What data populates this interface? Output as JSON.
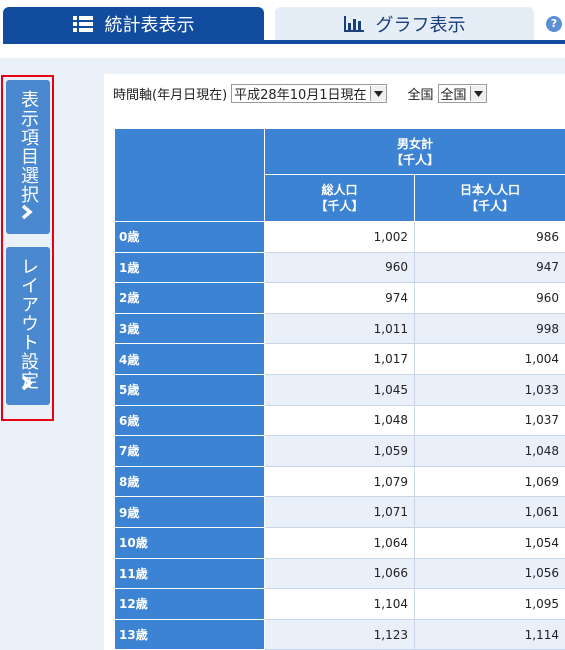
{
  "tabs": {
    "table": "統計表表示",
    "graph": "グラフ表示",
    "help": "?"
  },
  "side": {
    "display_items": "表示項目選択",
    "layout": "レイアウト設定"
  },
  "filters": {
    "time_label": "時間軸(年月日現在)",
    "time_value": "平成28年10月1日現在",
    "area_label": "全国",
    "area_value": "全国"
  },
  "table": {
    "group_header": "男女計",
    "group_unit": "【千人】",
    "columns": [
      {
        "label": "総人口",
        "unit": "【千人】"
      },
      {
        "label": "日本人人口",
        "unit": "【千人】"
      }
    ],
    "rows": [
      {
        "label": "0歳",
        "total": "1,002",
        "japanese": "986"
      },
      {
        "label": "1歳",
        "total": "960",
        "japanese": "947"
      },
      {
        "label": "2歳",
        "total": "974",
        "japanese": "960"
      },
      {
        "label": "3歳",
        "total": "1,011",
        "japanese": "998"
      },
      {
        "label": "4歳",
        "total": "1,017",
        "japanese": "1,004"
      },
      {
        "label": "5歳",
        "total": "1,045",
        "japanese": "1,033"
      },
      {
        "label": "6歳",
        "total": "1,048",
        "japanese": "1,037"
      },
      {
        "label": "7歳",
        "total": "1,059",
        "japanese": "1,048"
      },
      {
        "label": "8歳",
        "total": "1,079",
        "japanese": "1,069"
      },
      {
        "label": "9歳",
        "total": "1,071",
        "japanese": "1,061"
      },
      {
        "label": "10歳",
        "total": "1,064",
        "japanese": "1,054"
      },
      {
        "label": "11歳",
        "total": "1,066",
        "japanese": "1,056"
      },
      {
        "label": "12歳",
        "total": "1,104",
        "japanese": "1,095"
      },
      {
        "label": "13歳",
        "total": "1,123",
        "japanese": "1,114"
      }
    ]
  }
}
